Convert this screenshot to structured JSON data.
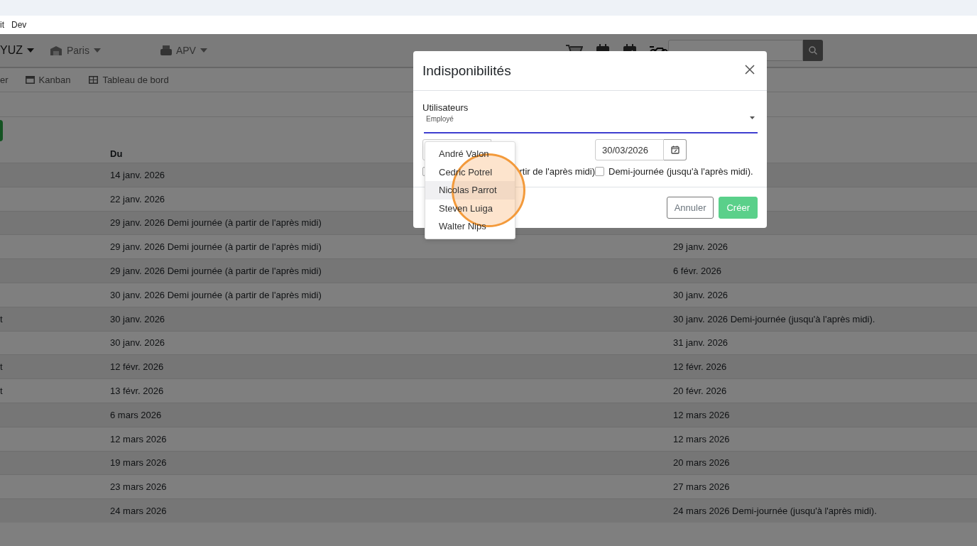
{
  "browser": {
    "bookmarks": [
      "it",
      "Dev"
    ]
  },
  "navbar": {
    "brand": "YUZ",
    "location": "Paris",
    "department": "APV"
  },
  "subnav": {
    "cut_item": "er",
    "items": [
      "Kanban",
      "Tableau de bord"
    ]
  },
  "table": {
    "header": "Du",
    "rows": [
      {
        "du": "14 janv. 2026"
      },
      {
        "du": "22 janv. 2026"
      },
      {
        "du": "29 janv. 2026 Demi journée (à partir de l'après midi)"
      },
      {
        "du": "29 janv. 2026 Demi journée (à partir de l'après midi)",
        "column_3": "29 janv. 2026"
      },
      {
        "du": "29 janv. 2026 Demi journée (à partir de l'après midi)",
        "column_3": "6 févr. 2026"
      },
      {
        "du": "30 janv. 2026 Demi journée (à partir de l'après midi)",
        "column_3": "30 janv. 2026"
      },
      {
        "column_1": "t",
        "du": "30 janv. 2026",
        "column_3": "30 janv. 2026 Demi-journée (jusqu'à l'après midi)."
      },
      {
        "du": "30 janv. 2026",
        "column_3": "31 janv. 2026"
      },
      {
        "column_1": "t",
        "du": "12 févr. 2026",
        "column_3": "12 févr. 2026"
      },
      {
        "column_1": "t",
        "du": "13 févr. 2026",
        "column_3": "20 févr. 2026"
      },
      {
        "du": "6 mars 2026",
        "column_3": "12 mars 2026"
      },
      {
        "du": "12 mars 2026",
        "column_3": "12 mars 2026"
      },
      {
        "du": "19 mars 2026",
        "column_3": "20 mars 2026"
      },
      {
        "du": "23 mars 2026",
        "column_3": "27 mars 2026"
      },
      {
        "du": "24 mars 2026",
        "column_3": "24 mars 2026 Demi-journée (jusqu'à l'après midi)."
      }
    ]
  },
  "modal": {
    "title": "Indisponibilités",
    "field_label": "Utilisateurs",
    "select_value": "Employé",
    "options": [
      {
        "label": "André Valon",
        "selected": false
      },
      {
        "label": "Cedric Potrel",
        "selected": false
      },
      {
        "label": "Nicolas Parrot",
        "selected": true
      },
      {
        "label": "Steven Luiga",
        "selected": false
      },
      {
        "label": "Walter Nips",
        "selected": false
      }
    ],
    "end_date": "30/03/2026",
    "start_half_day": {
      "label": "rtir de l'après midi)",
      "checked": false
    },
    "end_half_day": {
      "label": "Demi-journée (jusqu'à l'après midi).",
      "checked": false
    },
    "buttons": {
      "cancel": "Annuler",
      "create": "Créer"
    }
  }
}
